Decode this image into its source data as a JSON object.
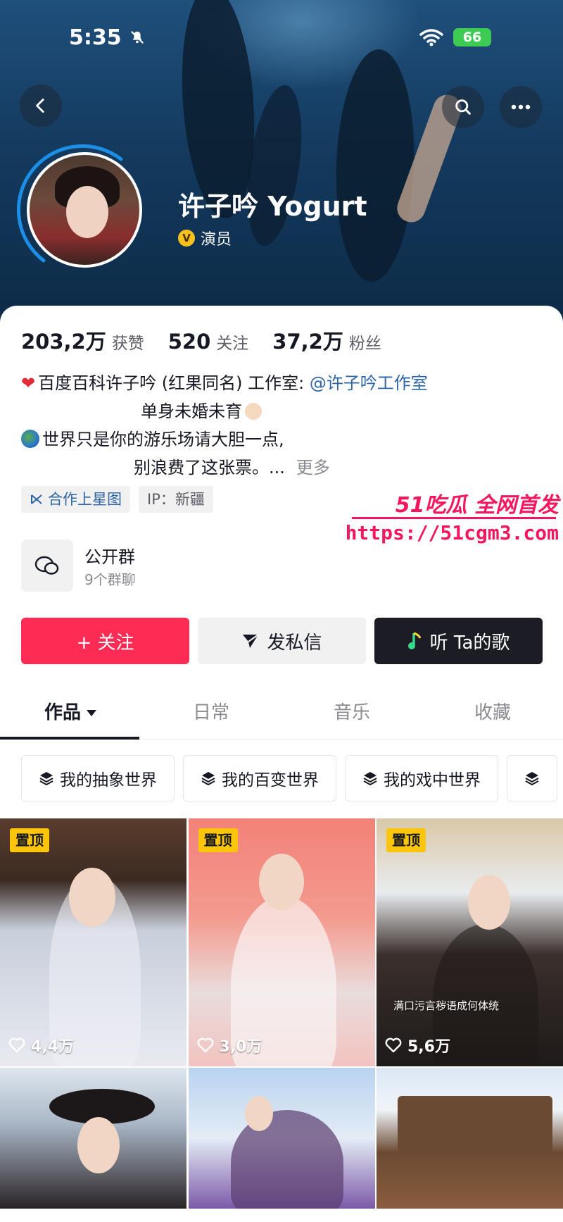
{
  "status": {
    "time": "5:35",
    "battery": "66"
  },
  "profile": {
    "name": "许子吟 Yogurt",
    "verify_badge": "V",
    "verify_label": "演员"
  },
  "stats": [
    {
      "value": "203,2万",
      "label": "获赞"
    },
    {
      "value": "520",
      "label": "关注"
    },
    {
      "value": "37,2万",
      "label": "粉丝"
    }
  ],
  "bio": {
    "line1_text": "百度百科许子吟 (红果同名) 工作室: ",
    "line1_mention": "@许子吟工作室",
    "line2": "单身未婚未育",
    "line3": "世界只是你的游乐场请大胆一点,",
    "line4": "别浪费了这张票。...",
    "more": "更多"
  },
  "tags": {
    "cooperate": "合作上星图",
    "ip": "IP：新疆"
  },
  "watermark": {
    "top": "51吃瓜 全网首发",
    "url": "https://51cgm3.com"
  },
  "group": {
    "title": "公开群",
    "subtitle": "9个群聊"
  },
  "actions": {
    "follow": "+ 关注",
    "message": "发私信",
    "music": "听 Ta的歌"
  },
  "tabs": [
    "作品",
    "日常",
    "音乐",
    "收藏"
  ],
  "collections": [
    "我的抽象世界",
    "我的百变世界",
    "我的戏中世界"
  ],
  "videos": [
    {
      "pinned": "置顶",
      "likes": "4,4万"
    },
    {
      "pinned": "置顶",
      "likes": "3,0万"
    },
    {
      "pinned": "置顶",
      "likes": "5,6万",
      "caption": "满口污言秽语成何体统"
    }
  ],
  "colors": {
    "accent": "#fe2c55",
    "link": "#2c64a8",
    "pin": "#fac50a",
    "watermark": "#f5175e"
  }
}
